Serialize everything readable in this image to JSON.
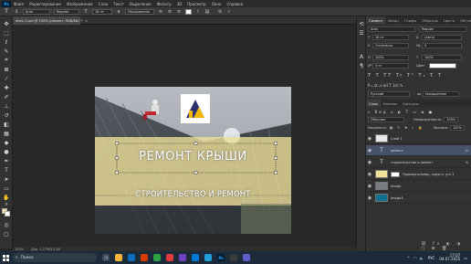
{
  "menubar": {
    "app_icon": "Ps",
    "items": [
      "Файл",
      "Редактирование",
      "Изображение",
      "Слои",
      "Текст",
      "Выделение",
      "Фильтр",
      "3D",
      "Просмотр",
      "Окно",
      "Справка"
    ]
  },
  "options": {
    "font_family": "Arial",
    "font_style": "Regular",
    "font_size": "18 пт",
    "antialias": "Насыщенное"
  },
  "document": {
    "tab_title": "deck-1.psd @ 100% (ремонт, RGB/8#) *",
    "close": "×"
  },
  "canvas": {
    "heading": "РЕМОНТ КРЫШИ",
    "subheading": "СТРОИТЕЛЬСТВО И РЕМОНТ"
  },
  "status": {
    "zoom": "100%",
    "doc_info": "Док: 1,27M/5,11M"
  },
  "character_panel": {
    "tabs": [
      "Символ",
      "Абзац",
      "Глифы",
      "Образцы",
      "Цвета",
      "Обучение"
    ],
    "font_family": "Arial",
    "font_style": "Regular",
    "size": "18 пт",
    "leading": "(Авто)",
    "kerning": "Оптически",
    "tracking": "0",
    "vscale": "100%",
    "hscale": "100%",
    "baseline": "0 пт",
    "color_label": "Цвет:",
    "language": "Русский",
    "aa": "Насыщенное"
  },
  "layers_panel": {
    "tabs": [
      "Слои",
      "Каналы",
      "Контуры"
    ],
    "blend_mode": "Обычные",
    "opacity_label": "Непрозрачность:",
    "opacity": "100%",
    "lock_label": "Закрепить:",
    "fill_label": "Заливка:",
    "fill": "100%",
    "layers": [
      {
        "name": "Слой 1",
        "type": "pixel",
        "thumb_color": "#e8e8e8"
      },
      {
        "name": "ремонт",
        "type": "text",
        "selected": true
      },
      {
        "name": "строительство и ремонт",
        "type": "text"
      },
      {
        "name": "Прямоугольник, скругл. угл 1",
        "type": "shape",
        "thumb_color": "#f1e29a"
      },
      {
        "name": "image",
        "type": "pixel",
        "thumb_color": "#7a7d82"
      },
      {
        "name": "image3",
        "type": "pixel",
        "thumb_color": "#0f6f8f"
      }
    ]
  },
  "taskbar": {
    "search_placeholder": "Поиск",
    "lang": "РУС",
    "time": "17:07",
    "date": "04.07.2025"
  },
  "colors": {
    "accent_yellow": "#f1e29a",
    "selection_blue": "#45526a",
    "taskbar": "#1c2b3a"
  }
}
